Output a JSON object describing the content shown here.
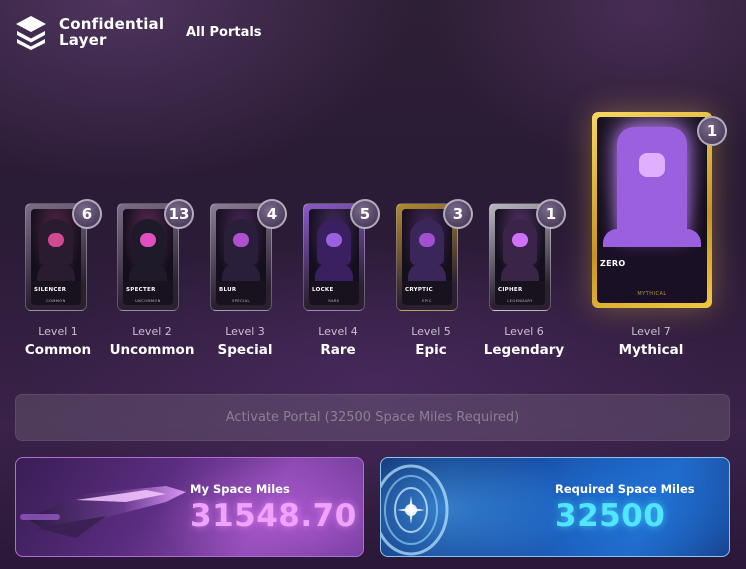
{
  "brand": {
    "name_line1": "Confidential",
    "name_line2": "Layer",
    "logo_icon": "stacked-layers-icon"
  },
  "nav": {
    "all_portals": "All Portals"
  },
  "tiers": [
    {
      "level": "Level 1",
      "rarity": "Common",
      "count": "6",
      "card_name": "SILENCER",
      "card_sub": "",
      "card_foot": "COMMON",
      "color": "#7a6e88"
    },
    {
      "level": "Level 2",
      "rarity": "Uncommon",
      "count": "13",
      "card_name": "SPECTER",
      "card_sub": "",
      "card_foot": "UNCOMMON",
      "color": "#7a6e88"
    },
    {
      "level": "Level 3",
      "rarity": "Special",
      "count": "4",
      "card_name": "BLUR",
      "card_sub": "",
      "card_foot": "SPECIAL",
      "color": "#8a7e98"
    },
    {
      "level": "Level 4",
      "rarity": "Rare",
      "count": "5",
      "card_name": "LOCKE",
      "card_sub": "",
      "card_foot": "RARE",
      "color": "#8a5ac8"
    },
    {
      "level": "Level 5",
      "rarity": "Epic",
      "count": "3",
      "card_name": "CRYPTIC",
      "card_sub": "",
      "card_foot": "EPIC",
      "color": "#b08a30"
    },
    {
      "level": "Level 6",
      "rarity": "Legendary",
      "count": "1",
      "card_name": "CIPHER",
      "card_sub": "",
      "card_foot": "LEGENDARY",
      "color": "#b8b8c0"
    },
    {
      "level": "Level 7",
      "rarity": "Mythical",
      "count": "1",
      "card_name": "ZERO",
      "card_sub": "",
      "card_foot": "MYTHICAL",
      "color": "#e2b830"
    }
  ],
  "activate_button": "Activate Portal (32500 Space Miles Required)",
  "my_miles": {
    "label": "My Space Miles",
    "value": "31548.70",
    "color": "#f0a2ff"
  },
  "required_miles": {
    "label": "Required Space Miles",
    "value": "32500",
    "color": "#4fe6ff"
  }
}
